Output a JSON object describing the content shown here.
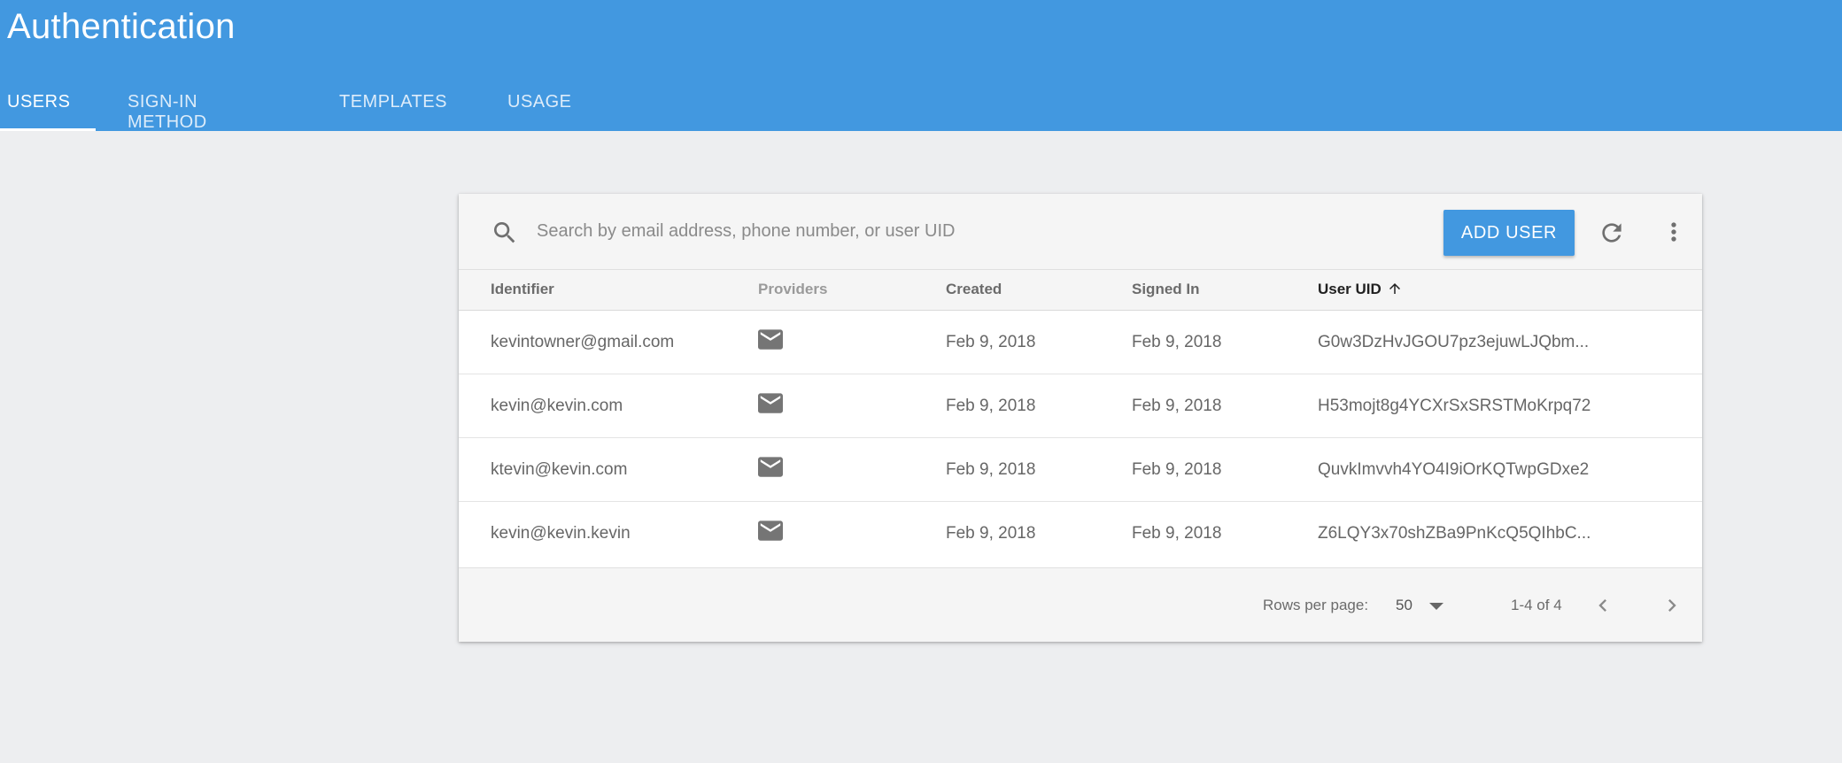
{
  "header": {
    "title": "Authentication",
    "tabs": [
      {
        "label": "USERS",
        "active": true
      },
      {
        "label": "SIGN-IN METHOD",
        "active": false
      },
      {
        "label": "TEMPLATES",
        "active": false
      },
      {
        "label": "USAGE",
        "active": false
      }
    ]
  },
  "toolbar": {
    "search_placeholder": "Search by email address, phone number, or user UID",
    "search_icon": "search-icon",
    "add_user_label": "ADD USER",
    "refresh_icon": "refresh-icon",
    "more_icon": "more-vert-icon"
  },
  "table": {
    "columns": {
      "identifier": "Identifier",
      "providers": "Providers",
      "created": "Created",
      "signed_in": "Signed In",
      "user_uid": "User UID"
    },
    "sort": {
      "column": "User UID",
      "direction": "ascending",
      "icon": "arrow-up-icon"
    },
    "rows": [
      {
        "identifier": "kevintowner@gmail.com",
        "provider_icon": "mail-icon",
        "created": "Feb 9, 2018",
        "signed_in": "Feb 9, 2018",
        "user_uid": "G0w3DzHvJGOU7pz3ejuwLJQbm..."
      },
      {
        "identifier": "kevin@kevin.com",
        "provider_icon": "mail-icon",
        "created": "Feb 9, 2018",
        "signed_in": "Feb 9, 2018",
        "user_uid": "H53mojt8g4YCXrSxSRSTMoKrpq72"
      },
      {
        "identifier": "ktevin@kevin.com",
        "provider_icon": "mail-icon",
        "created": "Feb 9, 2018",
        "signed_in": "Feb 9, 2018",
        "user_uid": "QuvkImvvh4YO4I9iOrKQTwpGDxe2"
      },
      {
        "identifier": "kevin@kevin.kevin",
        "provider_icon": "mail-icon",
        "created": "Feb 9, 2018",
        "signed_in": "Feb 9, 2018",
        "user_uid": "Z6LQY3x70shZBa9PnKcQ5QIhbC..."
      }
    ]
  },
  "pagination": {
    "rows_per_page_label": "Rows per page:",
    "rows_per_page_value": "50",
    "range_text": "1-4 of 4"
  },
  "colors": {
    "header_bg": "#4298e0",
    "page_bg": "#edeef0",
    "accent": "#4298e0"
  }
}
